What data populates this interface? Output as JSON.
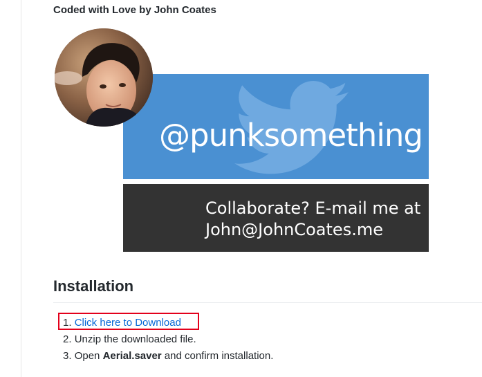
{
  "credit": "Coded with Love by John Coates",
  "banner": {
    "handle": "@punksomething",
    "contact_line1": "Collaborate? E-mail me at",
    "contact_line2": "John@JohnCoates.me",
    "twitter_color": "#4a90d2",
    "contact_color": "#333333"
  },
  "installation": {
    "heading": "Installation",
    "steps": [
      {
        "num": "1.",
        "link": "Click here to Download"
      },
      {
        "num": "2.",
        "text": "Unzip the downloaded file."
      },
      {
        "num": "3.",
        "text_before": "Open ",
        "bold": "Aerial.saver",
        "text_after": " and confirm installation."
      }
    ]
  },
  "highlight_color": "#e3001b",
  "link_color": "#0366d6"
}
